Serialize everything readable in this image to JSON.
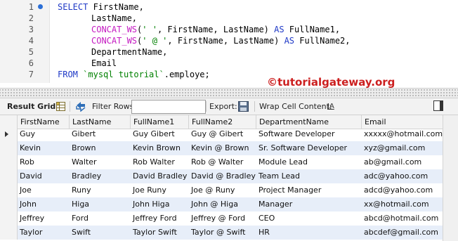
{
  "editor": {
    "line_numbers": [
      "1",
      "2",
      "3",
      "4",
      "5",
      "6",
      "7"
    ],
    "line1": {
      "kw": "SELECT",
      "rest": " FirstName,"
    },
    "line2": {
      "rest": "LastName,"
    },
    "line3": {
      "fn": "CONCAT_WS",
      "pre": "(",
      "str": "' '",
      "rest": ", FirstName, LastName) ",
      "kw": "AS",
      "tail": " FullName1,"
    },
    "line4": {
      "fn": "CONCAT_WS",
      "pre": "(",
      "str": "' @ '",
      "rest": ", FirstName, LastName) ",
      "kw": "AS",
      "tail": " FullName2,"
    },
    "line5": {
      "rest": "DepartmentName,"
    },
    "line6": {
      "rest": "Email"
    },
    "line7": {
      "kw": "FROM",
      "mid": " ",
      "str": "`mysql tutorial`",
      "tail": ".employe;"
    }
  },
  "watermark": "©tutorialgateway.org",
  "toolbar": {
    "result_grid": "Result Grid",
    "filter_rows": "Filter Rows:",
    "filter_value": "",
    "export": "Export:",
    "wrap": "Wrap Cell Content:",
    "wrap_icon": "IA"
  },
  "icons": {
    "grid": "grid-icon",
    "refresh": "refresh-icon",
    "export": "save-icon",
    "wrap": "wrap-icon",
    "panel": "panel-toggle-icon"
  },
  "colors": {
    "keyword": "#1f39c6",
    "function": "#c41bc2",
    "string": "#008000",
    "watermark": "#cc1f1f",
    "alt_row": "#e7eef9"
  },
  "grid": {
    "columns": [
      "FirstName",
      "LastName",
      "FullName1",
      "FullName2",
      "DepartmentName",
      "Email"
    ],
    "rows": [
      [
        "Guy",
        "Gibert",
        "Guy Gibert",
        "Guy @ Gibert",
        "Software Developer",
        "xxxxx@hotmail.com"
      ],
      [
        "Kevin",
        "Brown",
        "Kevin Brown",
        "Kevin @ Brown",
        "Sr. Software Developer",
        "xyz@gmail.com"
      ],
      [
        "Rob",
        "Walter",
        "Rob Walter",
        "Rob @ Walter",
        "Module Lead",
        "ab@gmail.com"
      ],
      [
        "David",
        "Bradley",
        "David Bradley",
        "David @ Bradley",
        "Team Lead",
        "adc@yahoo.com"
      ],
      [
        "Joe",
        "Runy",
        "Joe Runy",
        "Joe @ Runy",
        "Project Manager",
        "adcd@yahoo.com"
      ],
      [
        "John",
        "Higa",
        "John Higa",
        "John @ Higa",
        "Manager",
        "xx@hotmail.com"
      ],
      [
        "Jeffrey",
        "Ford",
        "Jeffrey Ford",
        "Jeffrey @ Ford",
        "CEO",
        "abcd@hotmail.com"
      ],
      [
        "Taylor",
        "Swift",
        "Taylor Swift",
        "Taylor @ Swift",
        "HR",
        "abcdef@gmail.com"
      ]
    ]
  }
}
